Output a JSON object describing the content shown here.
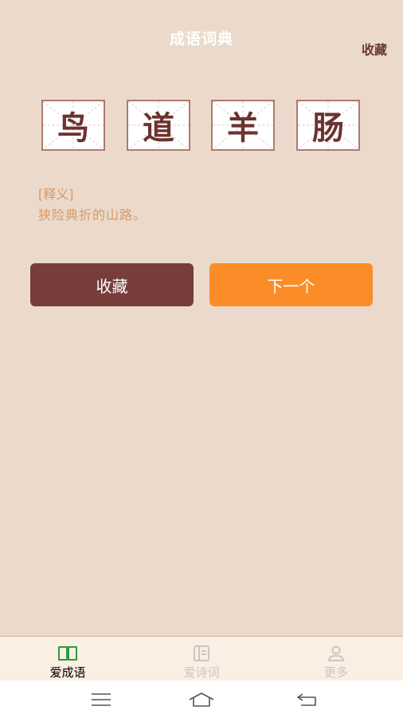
{
  "header": {
    "title": "成语词典",
    "favorite_link": "收藏"
  },
  "idiom": {
    "characters": [
      "鸟",
      "道",
      "羊",
      "肠"
    ]
  },
  "meaning": {
    "label": "[释义]",
    "text": "狭险典折的山路。"
  },
  "actions": {
    "favorite_label": "收藏",
    "next_label": "下一个"
  },
  "tabs": [
    {
      "label": "爱成语",
      "icon": "open-book-icon",
      "active": true
    },
    {
      "label": "爱诗词",
      "icon": "notebook-icon",
      "active": false
    },
    {
      "label": "更多",
      "icon": "person-icon",
      "active": false
    }
  ],
  "system_nav": {
    "buttons": [
      "menu-icon",
      "home-icon",
      "back-icon"
    ]
  },
  "colors": {
    "background": "#ebdacb",
    "brown": "#763d3a",
    "orange": "#fc8c27",
    "meaning": "#d79a66",
    "active_tab_icon": "#2e9a3e"
  }
}
